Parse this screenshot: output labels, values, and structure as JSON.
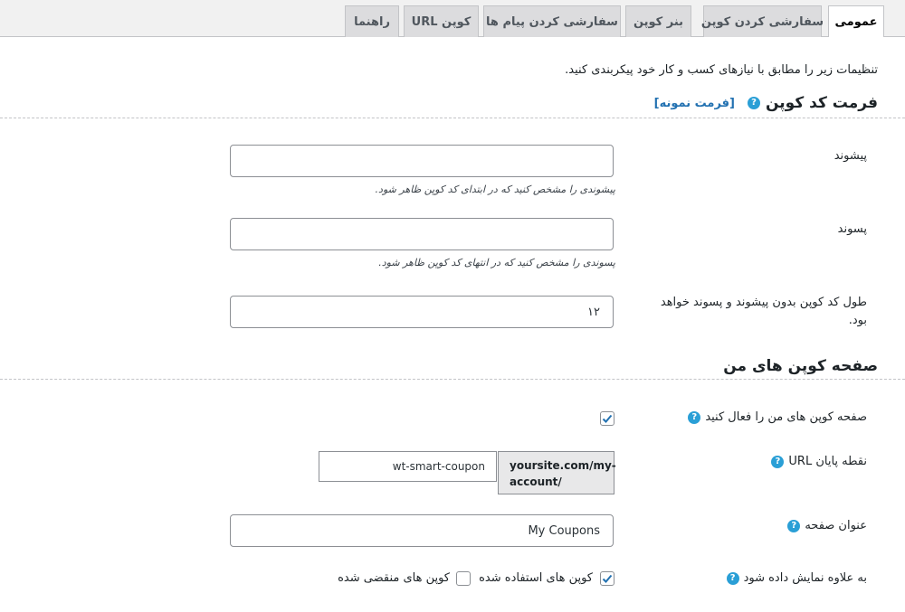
{
  "tabs": [
    {
      "label": "عمومی",
      "active": true
    },
    {
      "label": "سفارشی کردن کوپن",
      "active": false
    },
    {
      "label": "بنر کوپن",
      "active": false
    },
    {
      "label": "سفارشی کردن پیام ها",
      "active": false
    },
    {
      "label": "کوپن URL",
      "active": false
    },
    {
      "label": "راهنما",
      "active": false
    }
  ],
  "intro": "تنظیمات زیر را مطابق با نیازهای کسب و کار خود پیکربندی کنید.",
  "coupon_format": {
    "title": "فرمت کد کوپن",
    "sample_link": "[فرمت نمونه]",
    "prefix": {
      "label": "پیشوند",
      "value": "",
      "description": "پیشوندی را مشخص کنید که در ابتدای کد کوپن ظاهر شود."
    },
    "suffix": {
      "label": "پسوند",
      "value": "",
      "description": "پسوندی را مشخص کنید که در انتهای کد کوپن ظاهر شود."
    },
    "length": {
      "label": "طول کد کوپن بدون پیشوند و پسوند خواهد بود.",
      "value": "۱۲"
    }
  },
  "my_coupons": {
    "title": "صفحه کوپن های من",
    "enable": {
      "label": "صفحه کوپن های من را فعال کنید",
      "checked": true
    },
    "endpoint": {
      "label": "نقطه پایان URL",
      "prefix_line1": "yoursite.com/my-",
      "prefix_line2": "account/",
      "value": "wt-smart-coupon"
    },
    "page_title": {
      "label": "عنوان صفحه",
      "value": "My Coupons"
    },
    "display": {
      "label": "به علاوه نمایش داده شود",
      "used": {
        "label": "کوپن های استفاده شده",
        "checked": true
      },
      "expired": {
        "label": "کوپن های منقضی شده",
        "checked": false
      }
    }
  },
  "colors": {
    "accent": "#2271b1",
    "help": "#2a9fd6"
  }
}
